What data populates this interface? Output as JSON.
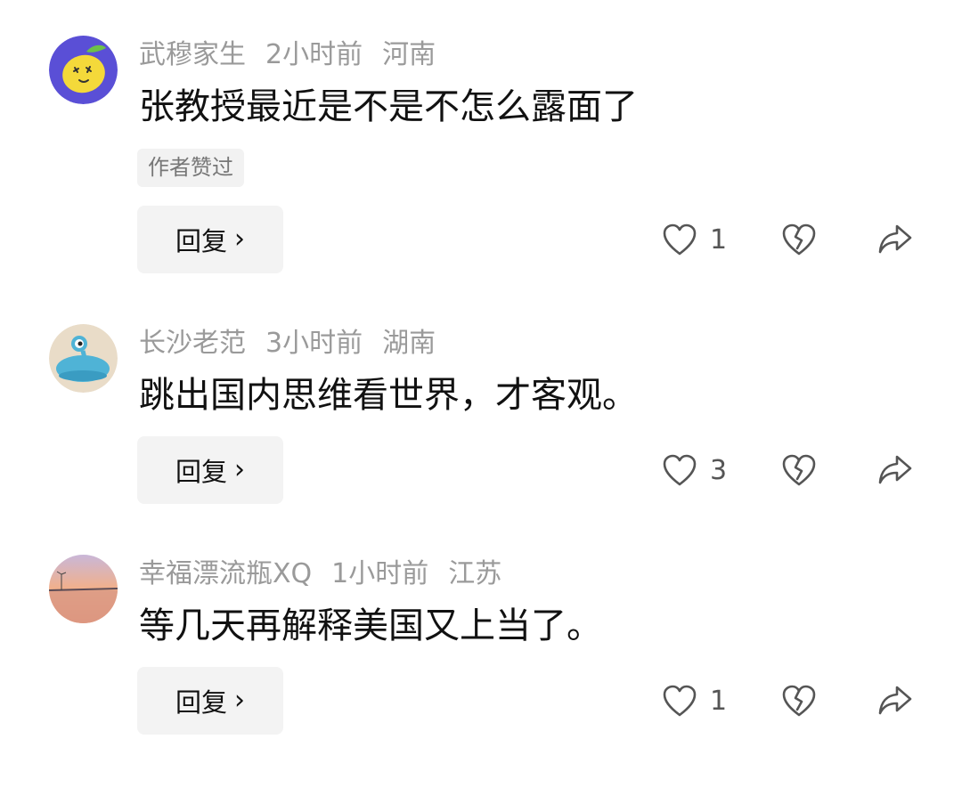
{
  "comments": [
    {
      "username": "武穆家生",
      "time": "2小时前",
      "location": "河南",
      "text": "张教授最近是不是不怎么露面了",
      "badge": "作者赞过",
      "reply_label": "回复",
      "reply_chevron": "›",
      "likes": "1",
      "avatar": "lemon-character-avatar"
    },
    {
      "username": "长沙老范",
      "time": "3小时前",
      "location": "湖南",
      "text": "跳出国内思维看世界，才客观。",
      "reply_label": "回复",
      "reply_chevron": "›",
      "likes": "3",
      "avatar": "blue-alien-avatar"
    },
    {
      "username": "幸福漂流瓶XQ",
      "time": "1小时前",
      "location": "江苏",
      "text": "等几天再解释美国又上当了。",
      "reply_label": "回复",
      "reply_chevron": "›",
      "likes": "1",
      "avatar": "sunset-beach-avatar"
    }
  ],
  "icons": {
    "like": "heart-outline-icon",
    "dislike": "broken-heart-icon",
    "share": "share-arrow-icon"
  }
}
